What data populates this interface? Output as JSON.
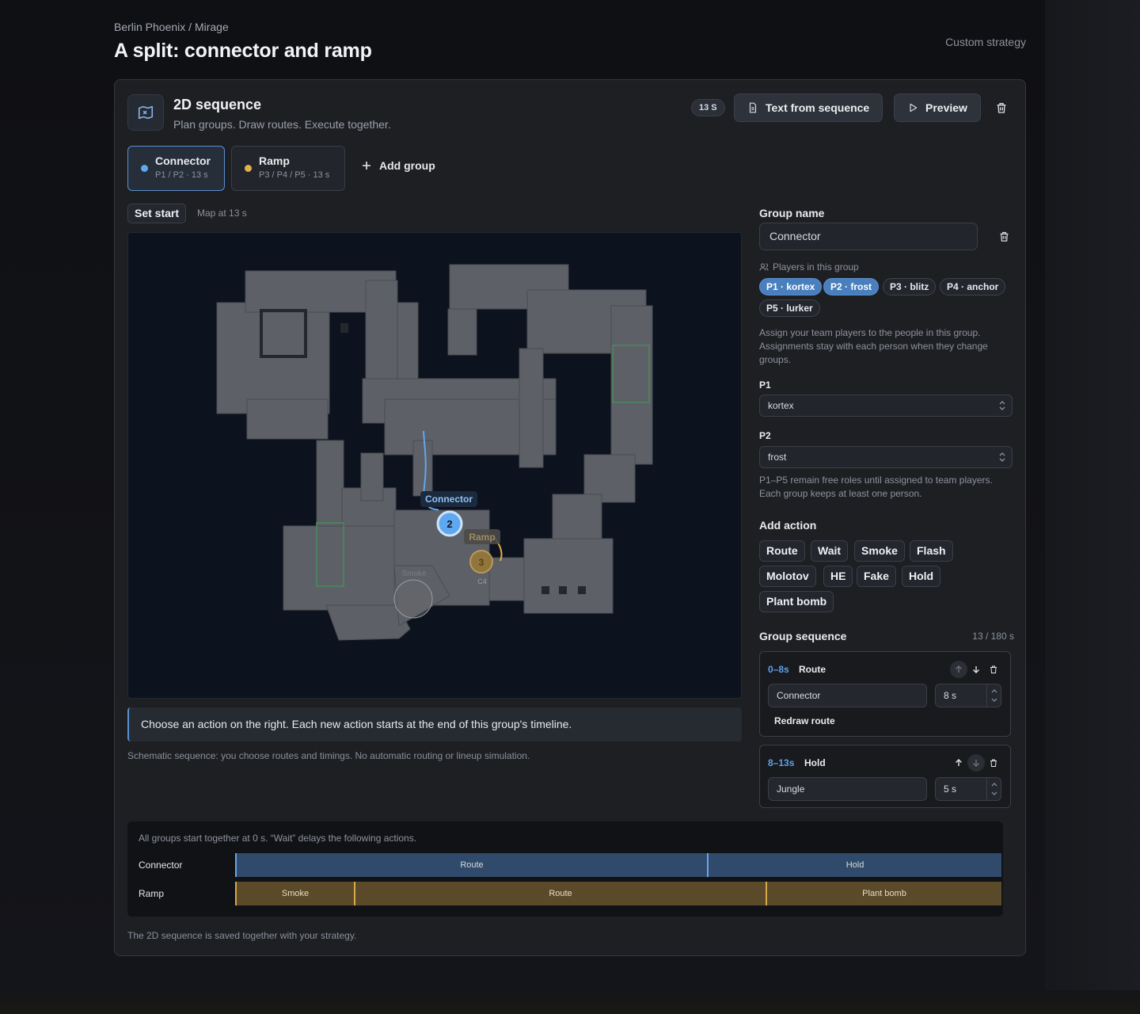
{
  "breadcrumb": "Berlin Phoenix / Mirage",
  "title": "A split: connector and ramp",
  "strategy_type": "Custom strategy",
  "card": {
    "title": "2D sequence",
    "subtitle": "Plan groups. Draw routes. Execute together.",
    "duration_badge": "13 S",
    "text_button": "Text from sequence",
    "preview_button": "Preview"
  },
  "groups": [
    {
      "name": "Connector",
      "meta": "P1 / P2 · 13 s",
      "color": "#5fa8f0",
      "active": true
    },
    {
      "name": "Ramp",
      "meta": "P3 / P4 / P5 · 13 s",
      "color": "#e0b04a",
      "active": false
    }
  ],
  "add_group_label": "Add group",
  "set_start_label": "Set start",
  "map_time_label": "Map at 13 s",
  "map": {
    "connector_label": "Connector",
    "connector_marker": "2",
    "ramp_label": "Ramp",
    "ramp_marker": "3",
    "smoke_label": "Smoke",
    "c4_label": "C4"
  },
  "hint": "Choose an action on the right. Each new action starts at the end of this group's timeline.",
  "footnote": "Schematic sequence: you choose routes and timings. No automatic routing or lineup simulation.",
  "panel": {
    "group_name_label": "Group name",
    "group_name_value": "Connector",
    "players_label": "Players in this group",
    "players": [
      {
        "label": "P1 · kortex",
        "selected": true
      },
      {
        "label": "P2 · frost",
        "selected": true
      },
      {
        "label": "P3 · blitz",
        "selected": false
      },
      {
        "label": "P4 · anchor",
        "selected": false
      },
      {
        "label": "P5 · lurker",
        "selected": false
      }
    ],
    "assign_text": "Assign your team players to the people in this group. Assignments stay with each person when they change groups.",
    "p1_label": "P1",
    "p1_value": "kortex",
    "p2_label": "P2",
    "p2_value": "frost",
    "roles_text": "P1–P5 remain free roles until assigned to team players. Each group keeps at least one person.",
    "add_action_label": "Add action",
    "actions": [
      "Route",
      "Wait",
      "Smoke",
      "Flash",
      "Molotov",
      "HE",
      "Fake",
      "Hold",
      "Plant bomb"
    ],
    "sequence_label": "Group sequence",
    "sequence_count": "13 / 180 s",
    "sequence": [
      {
        "time": "0–8s",
        "type": "Route",
        "target": "Connector",
        "duration": "8 s",
        "extra": "Redraw route"
      },
      {
        "time": "8–13s",
        "type": "Hold",
        "target": "Jungle",
        "duration": "5 s"
      }
    ]
  },
  "timeline": {
    "note": "All groups start together at 0 s. “Wait” delays the following actions.",
    "rows": [
      {
        "label": "Connector",
        "segments": [
          {
            "label": "Route"
          },
          {
            "label": "Hold"
          }
        ]
      },
      {
        "label": "Ramp",
        "segments": [
          {
            "label": "Smoke"
          },
          {
            "label": "Route"
          },
          {
            "label": "Plant bomb"
          }
        ]
      }
    ]
  },
  "saved_note": "The 2D sequence is saved together with your strategy.",
  "colors": {
    "accent_blue": "#5fa8f0",
    "accent_gold": "#e0b04a"
  }
}
